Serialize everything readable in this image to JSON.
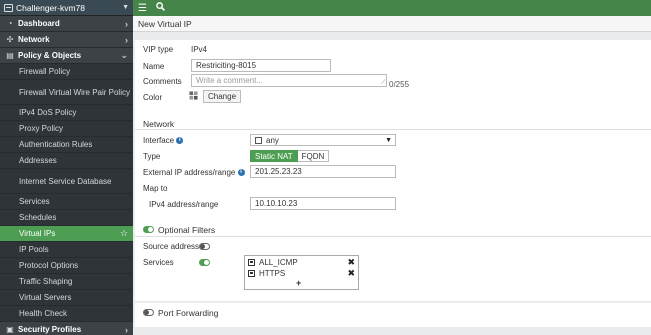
{
  "sidebar": {
    "device_name": "Challenger-kvm78",
    "items": [
      {
        "label": "Dashboard",
        "icon": "dashboard-icon",
        "type": "section"
      },
      {
        "label": "Network",
        "icon": "network-icon",
        "type": "section"
      },
      {
        "label": "Policy & Objects",
        "icon": "policy-icon",
        "type": "section-expanded"
      },
      {
        "label": "Firewall Policy"
      },
      {
        "label": "Firewall Virtual Wire Pair Policy"
      },
      {
        "label": "IPv4 DoS Policy"
      },
      {
        "label": "Proxy Policy"
      },
      {
        "label": "Authentication Rules"
      },
      {
        "label": "Addresses"
      },
      {
        "label": "Internet Service Database"
      },
      {
        "label": "Services"
      },
      {
        "label": "Schedules"
      },
      {
        "label": "Virtual IPs",
        "active": true
      },
      {
        "label": "IP Pools"
      },
      {
        "label": "Protocol Options"
      },
      {
        "label": "Traffic Shaping"
      },
      {
        "label": "Virtual Servers"
      },
      {
        "label": "Health Check"
      },
      {
        "label": "Security Profiles",
        "icon": "lock-icon",
        "type": "section"
      }
    ]
  },
  "page": {
    "title": "New Virtual IP"
  },
  "vip": {
    "vip_type_label": "VIP type",
    "vip_type_value": "IPv4",
    "name_label": "Name",
    "name_value": "Restriciting-8015",
    "comments_label": "Comments",
    "comments_placeholder": "Write a comment...",
    "comments_counter": "0/255",
    "color_label": "Color",
    "color_button": "Change"
  },
  "network": {
    "section_title": "Network",
    "interface_label": "Interface",
    "interface_value": "any",
    "type_label": "Type",
    "type_options": [
      "Static NAT",
      "FQDN"
    ],
    "type_selected": "Static NAT",
    "external_ip_label": "External IP address/range",
    "external_ip_value": "201.25.23.23",
    "map_to_label": "Map to",
    "ipv4_label": "IPv4 address/range",
    "ipv4_value": "10.10.10.23"
  },
  "filters": {
    "title": "Optional Filters",
    "enabled": true,
    "source_label": "Source address",
    "source_enabled": false,
    "services_label": "Services",
    "services_enabled": true,
    "services": [
      "ALL_ICMP",
      "HTTPS"
    ],
    "add_symbol": "+"
  },
  "port_forwarding": {
    "title": "Port Forwarding",
    "enabled": false
  },
  "colors": {
    "accent_green": "#4d9e53",
    "topbar_green": "#45854a",
    "sidebar_bg": "#2f3438",
    "info_blue": "#2a6fb2"
  }
}
